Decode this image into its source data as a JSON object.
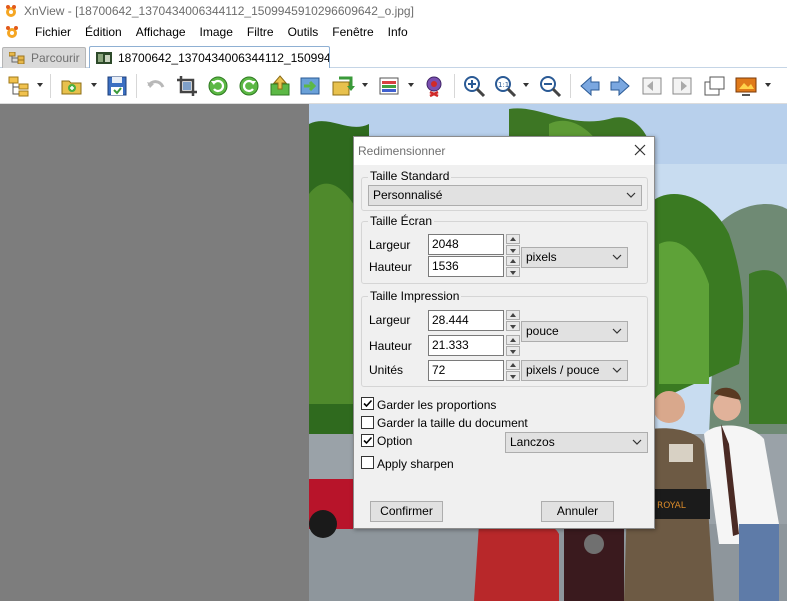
{
  "window": {
    "title": "XnView - [18700642_1370434006344112_1509945910296609642_o.jpg]"
  },
  "menu": [
    "Fichier",
    "Édition",
    "Affichage",
    "Image",
    "Filtre",
    "Outils",
    "Fenêtre",
    "Info"
  ],
  "tabs": [
    {
      "label": "Parcourir"
    },
    {
      "label": "18700642_1370434006344112_150994..."
    }
  ],
  "toolbar": {
    "icons": [
      "tree-view-icon",
      "open-folder-icon",
      "save-icon",
      "undo-icon",
      "crop-icon",
      "rotate-left-icon",
      "rotate-right-icon",
      "acquire-icon",
      "convert-icon",
      "batch-icon",
      "adjust-colors-icon",
      "red-eye-icon",
      "zoom-in-icon",
      "zoom-fit-icon",
      "zoom-out-icon",
      "previous-icon",
      "next-icon",
      "first-icon",
      "last-icon",
      "fullscreen-icon",
      "slideshow-icon"
    ]
  },
  "dialog": {
    "title": "Redimensionner",
    "standard": {
      "legend": "Taille Standard",
      "selected": "Personnalisé"
    },
    "screen": {
      "legend": "Taille Écran",
      "width_label": "Largeur",
      "width_value": "2048",
      "height_label": "Hauteur",
      "height_value": "1536",
      "unit": "pixels"
    },
    "print": {
      "legend": "Taille Impression",
      "width_label": "Largeur",
      "width_value": "28.444",
      "height_label": "Hauteur",
      "height_value": "21.333",
      "unit": "pouce",
      "units_label": "Unités",
      "units_value": "72",
      "units_unit": "pixels / pouce"
    },
    "options": {
      "keep_proportions": {
        "label": "Garder les proportions",
        "checked": true
      },
      "keep_document_size": {
        "label": "Garder la taille du document",
        "checked": false
      },
      "option": {
        "label": "Option",
        "checked": true
      },
      "filter": "Lanczos",
      "apply_sharpen": {
        "label": "Apply sharpen",
        "checked": false
      }
    },
    "buttons": {
      "confirm": "Confirmer",
      "cancel": "Annuler"
    }
  },
  "colors": {
    "sky": "#c8dcf0",
    "tree": "#2f6a1e",
    "gray_panel": "#7d7d7d",
    "accent_blue": "#3b7dd8"
  }
}
